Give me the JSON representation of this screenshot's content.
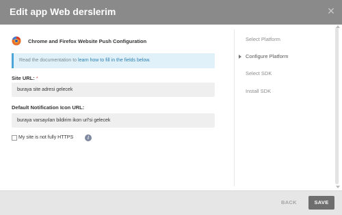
{
  "dialog": {
    "title": "Edit app Web derslerim",
    "close_icon": "close-icon"
  },
  "config": {
    "heading": "Chrome and Firefox Website Push Configuration",
    "browser_icon": "chrome-firefox-icon",
    "info_prefix": "Read the documentation to ",
    "info_link": "learn how to fill in the fields below."
  },
  "form": {
    "site_url_label": "Site URL:",
    "site_url_required": "*",
    "site_url_value": "buraya site adresi gelecek",
    "icon_url_label": "Default Notification Icon URL:",
    "icon_url_value": "buraya varsayılan bildirim ikon url'si gelecek",
    "https_label": "My site is not fully HTTPS",
    "https_checked": false,
    "https_info_icon": "info-icon"
  },
  "steps": {
    "items": [
      {
        "label": "Select Platform",
        "active": false
      },
      {
        "label": "Configure Platform",
        "active": true
      },
      {
        "label": "Select SDK",
        "active": false
      },
      {
        "label": "Install SDK",
        "active": false
      }
    ]
  },
  "footer": {
    "back_label": "BACK",
    "save_label": "SAVE"
  },
  "colors": {
    "titlebar": "#8a8a8a",
    "info_accent": "#4aa6d6",
    "save_button": "#6e6e6e"
  }
}
